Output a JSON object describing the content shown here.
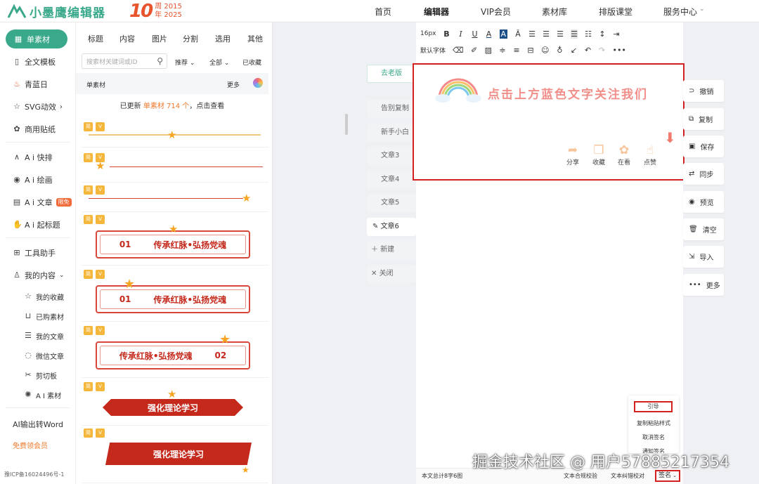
{
  "header": {
    "logo_text": "小墨鹰编辑器",
    "anniversary_big": "10",
    "anniversary_line1": "周 2015",
    "anniversary_line2": "年 2025",
    "nav": [
      "首页",
      "编辑器",
      "VIP会员",
      "素材库",
      "排版课堂",
      "服务中心"
    ],
    "active_nav": "编辑器"
  },
  "sidebar": {
    "active_item": "单素材",
    "items": [
      "全文模板",
      "青蓝日",
      "SVG动效",
      "商用贴纸",
      "A i 快排",
      "A i 绘画",
      "A i 文章",
      "A i 起标题",
      "工具助手",
      "我的内容"
    ],
    "ai_article_badge": "限免",
    "sub_items": [
      "我的收藏",
      "已购素材",
      "我的文章",
      "微信文章",
      "剪切板",
      "A I 素材"
    ],
    "ai_word": "AI输出转Word",
    "free_vip": "免费领会员",
    "icp": "豫ICP备16024496号-1"
  },
  "panel": {
    "categories": [
      "标题",
      "内容",
      "图片",
      "分割",
      "选用",
      "其他"
    ],
    "search_placeholder": "搜索材关键词或ID",
    "filters": [
      "推荐",
      "全部",
      "已收藏"
    ],
    "list_title": "单素材",
    "more": "更多",
    "updated_prefix": "已更新",
    "updated_highlight": "单素材 714 个",
    "updated_suffix": "，点击查看",
    "tag_a": "简",
    "tag_b": "V",
    "cards": [
      {
        "num": "01",
        "text": "传承红脉•弘扬党魂"
      },
      {
        "num": "01",
        "text": "传承红脉•弘扬党魂"
      },
      {
        "num": "02",
        "text": "传承红脉•弘扬党魂"
      },
      {
        "text": "强化理论学习"
      },
      {
        "text": "强化理论学习"
      }
    ]
  },
  "doc_tabs": {
    "old_version": "去老版",
    "tabs": [
      "告别复制",
      "新手小白",
      "文章3",
      "文章4",
      "文章5",
      "文章6"
    ],
    "current": "文章6",
    "new_label": "新建",
    "close_label": "关闭"
  },
  "toolbar": {
    "font_size": "16px",
    "default_font": "默认字体"
  },
  "editor": {
    "banner_text": "点击上方蓝色文字关注我们",
    "actions": [
      "分享",
      "收藏",
      "在看",
      "点赞"
    ]
  },
  "right_actions": [
    "撤销",
    "复制",
    "保存",
    "同步",
    "预览",
    "清空",
    "导入",
    "更多"
  ],
  "sign_menu": [
    "引导",
    "复制粘贴样式",
    "取消签名",
    "通知签名"
  ],
  "status": {
    "word_count": "本文总计8字6图",
    "compliance": "文本合规校验",
    "proofread": "文本纠错校对",
    "sign": "签名"
  },
  "watermark": "掘金技术社区 @ 用户57885217354"
}
